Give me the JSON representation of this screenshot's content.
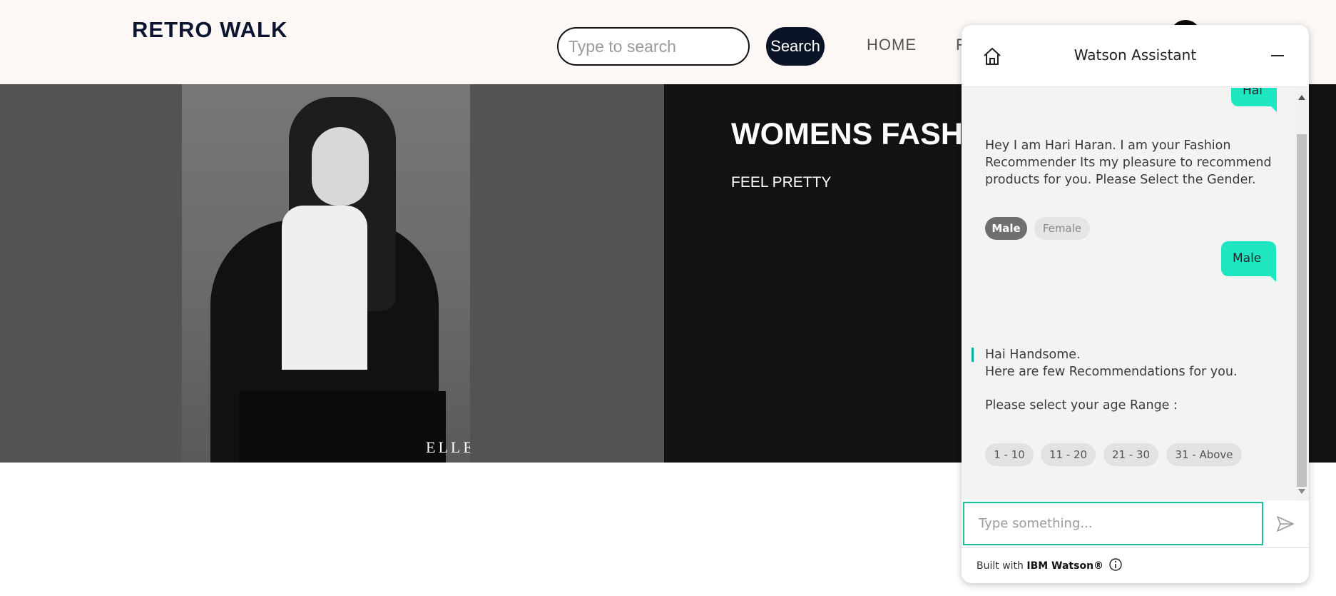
{
  "header": {
    "brand": "RETRO WALK",
    "search_placeholder": "Type to search",
    "search_button": "Search",
    "nav": {
      "home": "HOME",
      "next": "F"
    }
  },
  "hero": {
    "title": "WOMENS FASHION",
    "subtitle": "FEEL PRETTY",
    "photo_watermark": "ELLE"
  },
  "chat": {
    "title": "Watson Assistant",
    "messages": {
      "user_top": "Hai",
      "bot_intro": "Hey I am Hari Haran. I am your Fashion Recommender Its my pleasure to recommend products for you. Please Select the Gender.",
      "user_male": "Male",
      "bot_greet": "Hai Handsome.",
      "bot_greet2": "Here are few Recommendations for you.",
      "bot_age": "Please select your age Range :"
    },
    "gender_options": [
      "Male",
      "Female"
    ],
    "age_options": [
      "1 - 10",
      "11 - 20",
      "21 - 30",
      "31 - Above"
    ],
    "help_label": "?",
    "input_placeholder": "Type something...",
    "footer_prefix": "Built with ",
    "footer_brand": "IBM Watson®",
    "colors": {
      "accent": "#1ee6c0",
      "focus": "#1dbf9b",
      "help": "#00c19a"
    }
  }
}
